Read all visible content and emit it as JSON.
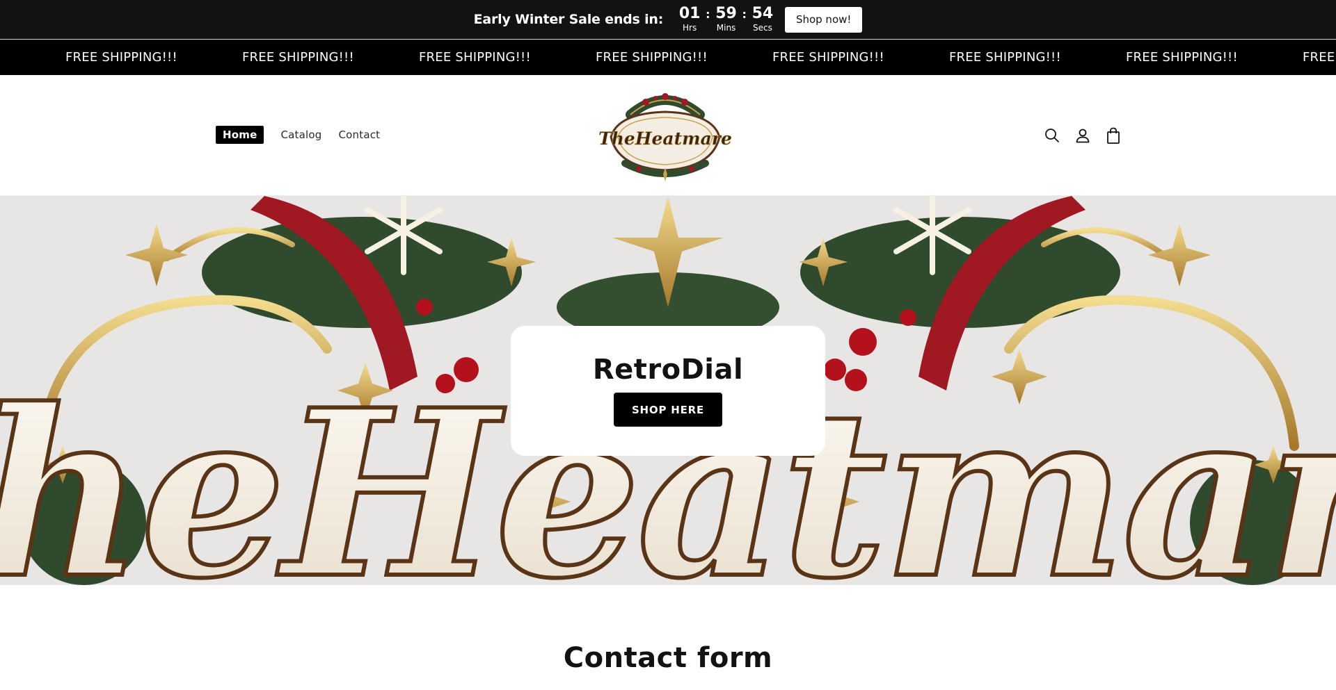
{
  "announcement": {
    "heading": "Early Winter Sale ends in:",
    "hours": "01",
    "hours_label": "Hrs",
    "minutes": "59",
    "minutes_label": "Mins",
    "seconds": "54",
    "seconds_label": "Secs",
    "separator": ":",
    "button_label": "Shop now!"
  },
  "marquee": {
    "items": [
      "FREE SHIPPING!!!",
      "FREE SHIPPING!!!",
      "FREE SHIPPING!!!",
      "FREE SHIPPING!!!",
      "FREE SHIPPING!!!",
      "FREE SHIPPING!!!",
      "FREE SHIPPING!!!",
      "FREE SHIPPING!!!"
    ]
  },
  "header": {
    "nav": [
      {
        "label": "Home",
        "active": true
      },
      {
        "label": "Catalog",
        "active": false
      },
      {
        "label": "Contact",
        "active": false
      }
    ],
    "logo_text": "TheHeatmare",
    "icons": [
      "search-icon",
      "account-icon",
      "cart-icon"
    ]
  },
  "hero": {
    "banner_text": "TheHeatmare",
    "title": "RetroDial",
    "button_label": "SHOP HERE"
  },
  "contact": {
    "title": "Contact form"
  },
  "colors": {
    "bar_background": "#121212",
    "marquee_background": "#000000",
    "hero_background": "#e8e6e5",
    "gold": "#c9a24a",
    "red": "#a01822",
    "green": "#2f4a2c"
  }
}
